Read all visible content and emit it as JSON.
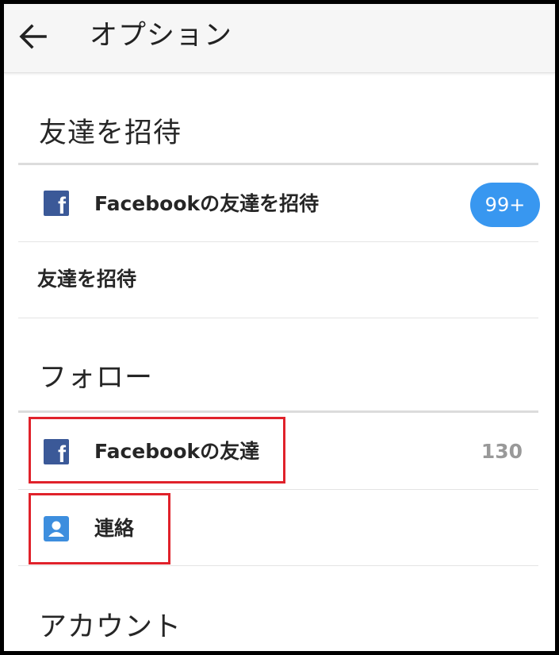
{
  "header": {
    "title": "オプション",
    "back_icon": "arrow-left-icon"
  },
  "sections": {
    "invite": {
      "title": "友達を招待",
      "items": [
        {
          "label": "Facebookの友達を招待",
          "icon": "facebook-icon",
          "badge": "99+"
        },
        {
          "label": "友達を招待"
        }
      ]
    },
    "follow": {
      "title": "フォロー",
      "items": [
        {
          "label": "Facebookの友達",
          "icon": "facebook-icon",
          "count": "130"
        },
        {
          "label": "連絡",
          "icon": "contacts-icon"
        }
      ]
    },
    "account": {
      "title": "アカウント"
    }
  },
  "colors": {
    "facebook_blue": "#3b5998",
    "badge_blue": "#3897f0",
    "contacts_blue": "#3d8ede",
    "highlight_red": "#e0222b"
  }
}
